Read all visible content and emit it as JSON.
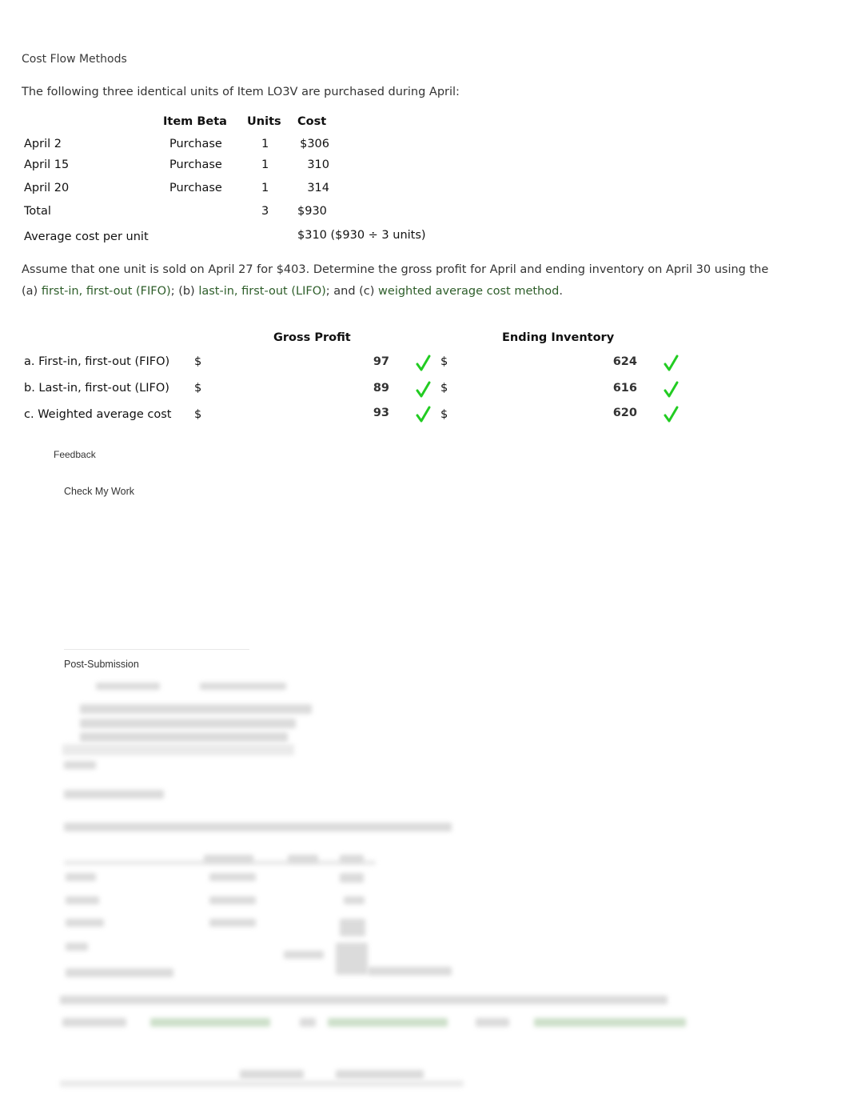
{
  "title": "Cost Flow Methods",
  "intro": "The following three identical units of Item LO3V are purchased during April:",
  "purchases": {
    "headers": [
      "Item Beta",
      "Units",
      "Cost"
    ],
    "rows": [
      {
        "date": "April 2",
        "type": "Purchase",
        "units": "1",
        "cost": "$306"
      },
      {
        "date": "April 15",
        "type": "Purchase",
        "units": "1",
        "cost": "310"
      },
      {
        "date": "April 20",
        "type": "Purchase",
        "units": "1",
        "cost": "314"
      }
    ],
    "total": {
      "label": "Total",
      "units": "3",
      "cost": "$930"
    },
    "average": {
      "label": "Average cost per unit",
      "value": "$310 ($930 ÷ 3 units)"
    }
  },
  "question": {
    "text1": "Assume that one unit is sold on April 27 for $403. Determine the gross profit for April and ending inventory on April 30 using the",
    "a_prefix": "(a) ",
    "a_link": "first-in, first-out (FIFO)",
    "b_prefix": "; (b) ",
    "b_link": "last-in, first-out (LIFO)",
    "c_prefix": "; and (c) ",
    "c_link": "weighted average cost method",
    "suffix": "."
  },
  "answers": {
    "headers": {
      "gross_profit": "Gross Profit",
      "ending_inventory": "Ending Inventory"
    },
    "currency": "$",
    "rows": [
      {
        "label": "a. First-in, first-out (FIFO)",
        "gross_profit": "97",
        "gp_status": "correct",
        "ending_inventory": "624",
        "ei_status": "correct"
      },
      {
        "label": "b. Last-in, first-out (LIFO)",
        "gross_profit": "89",
        "gp_status": "correct",
        "ending_inventory": "616",
        "ei_status": "correct"
      },
      {
        "label": "c. Weighted average cost",
        "gross_profit": "93",
        "gp_status": "correct",
        "ending_inventory": "620",
        "ei_status": "correct"
      }
    ]
  },
  "feedback_label": "Feedback",
  "check_my_work_label": "Check My Work",
  "post_submission_label": "Post-Submission",
  "colors": {
    "link_green": "#2e5e2a",
    "check_green": "#22cc22",
    "text": "#333333"
  }
}
